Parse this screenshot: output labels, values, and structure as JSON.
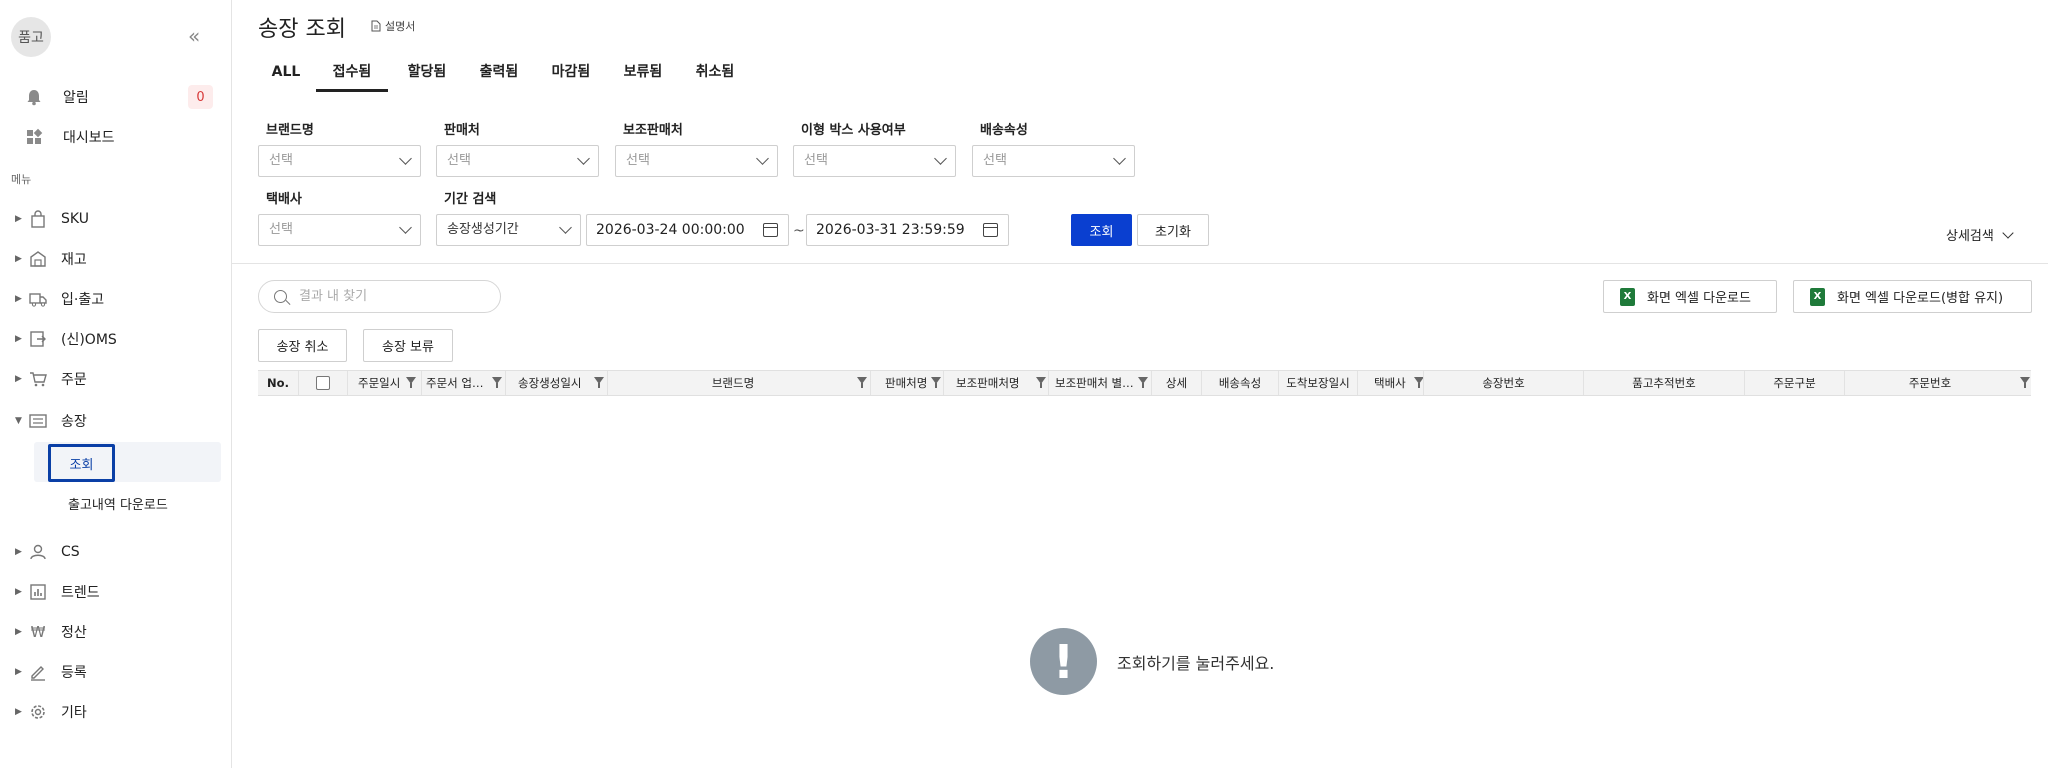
{
  "sidebar": {
    "logo": "품고",
    "collapse_icon": "«",
    "alert_label": "알림",
    "alert_count": "0",
    "dashboard_label": "대시보드",
    "menu_heading": "메뉴",
    "items": [
      {
        "label": "SKU",
        "icon": "bag-icon"
      },
      {
        "label": "재고",
        "icon": "warehouse-icon"
      },
      {
        "label": "입·출고",
        "icon": "truck-icon"
      },
      {
        "label": "(신)OMS",
        "icon": "oms-icon"
      },
      {
        "label": "주문",
        "icon": "cart-icon"
      },
      {
        "label": "송장",
        "icon": "list-icon",
        "expanded": true
      },
      {
        "label": "CS",
        "icon": "person-icon"
      },
      {
        "label": "트렌드",
        "icon": "chart-icon"
      },
      {
        "label": "정산",
        "icon": "won-icon"
      },
      {
        "label": "등록",
        "icon": "pen-icon"
      },
      {
        "label": "기타",
        "icon": "gear-icon"
      }
    ],
    "sub_items": [
      "조회",
      "출고내역 다운로드"
    ]
  },
  "header": {
    "title": "송장 조회",
    "manual": "설명서"
  },
  "tabs": [
    "ALL",
    "접수됨",
    "할당됨",
    "출력됨",
    "마감됨",
    "보류됨",
    "취소됨"
  ],
  "active_tab": "접수됨",
  "filters": {
    "brand_label": "브랜드명",
    "seller_label": "판매처",
    "sub_seller_label": "보조판매처",
    "box_label": "이형 박스 사용여부",
    "shipping_attr_label": "배송속성",
    "courier_label": "택배사",
    "period_label": "기간 검색",
    "placeholder": "선택",
    "period_type": "송장생성기간",
    "date_from": "2026-03-24 00:00:00",
    "date_to": "2026-03-31 23:59:59",
    "tilde": "~",
    "search_button": "조회",
    "reset_button": "초기화",
    "detail_search": "상세검색"
  },
  "toolbar": {
    "search_placeholder": "결과 내 찾기",
    "excel_download": "화면 엑셀 다운로드",
    "excel_download_merge": "화면 엑셀 다운로드(병합 유지)",
    "cancel_invoice": "송장 취소",
    "hold_invoice": "송장 보류"
  },
  "table": {
    "columns": [
      "No.",
      "",
      "주문일시",
      "주문서 업…",
      "송장생성일시",
      "브랜드명",
      "판매처명",
      "보조판매처명",
      "보조판매처 별…",
      "상세",
      "배송속성",
      "도착보장일시",
      "택배사",
      "송장번호",
      "품고추적번호",
      "주문구분",
      "주문번호"
    ]
  },
  "empty": {
    "icon": "!",
    "message": "조회하기를 눌러주세요."
  },
  "colors": {
    "primary": "#0a3fd0",
    "selected_outline": "#0a3fa6",
    "badge_text": "#d83a3a",
    "excel_green": "#1f7a3a"
  }
}
